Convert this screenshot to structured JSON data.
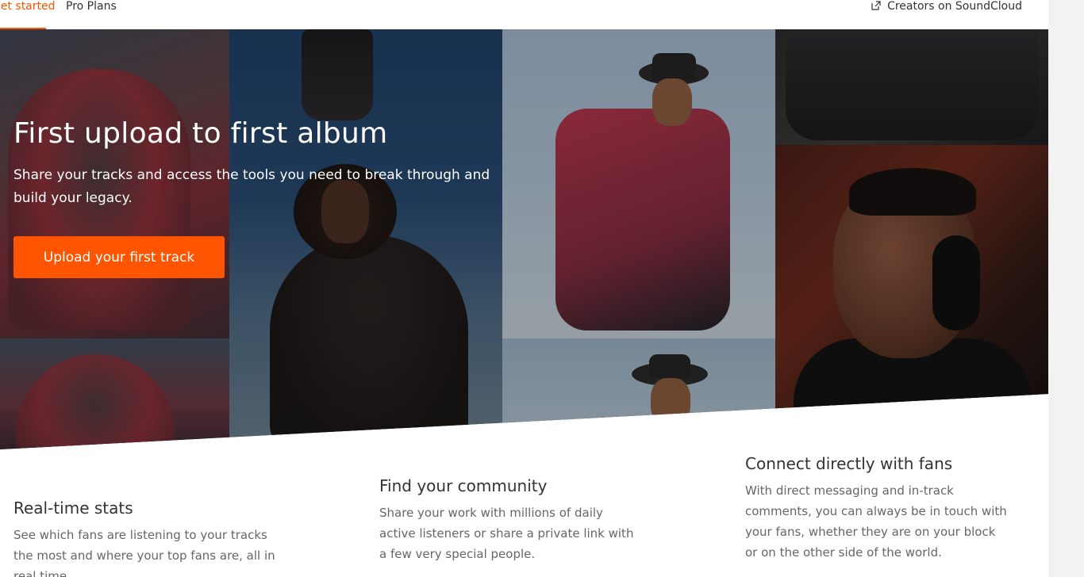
{
  "nav": {
    "tabs": [
      {
        "label": "Get started",
        "active": true
      },
      {
        "label": "Pro Plans",
        "active": false
      }
    ],
    "external_link": {
      "label": "Creators on SoundCloud",
      "icon": "external-link-icon"
    }
  },
  "hero": {
    "title": "First upload to first album",
    "subtitle": "Share your tracks and access the tools you need to break through and build your legacy.",
    "cta_label": "Upload your first track"
  },
  "features": [
    {
      "title": "Real-time stats",
      "text": "See which fans are listening to your tracks the most and where your top fans are, all in real time."
    },
    {
      "title": "Find your community",
      "text": "Share your work with millions of daily active listeners or share a private link with a few very special people."
    },
    {
      "title": "Connect directly with fans",
      "text": "With direct messaging and in-track comments, you can always be in touch with your fans, whether they are on your block or on the other side of the world."
    }
  ],
  "colors": {
    "accent": "#ff5500",
    "text": "#333333",
    "muted": "#666666",
    "page_bg": "#ffffff",
    "gutter_bg": "#f2f2f2"
  }
}
